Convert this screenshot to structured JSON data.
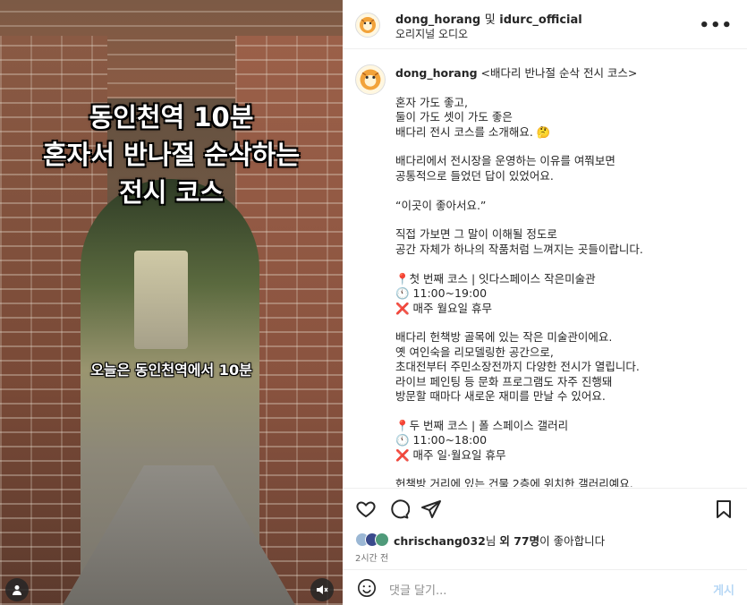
{
  "video": {
    "overlay_title_lines": [
      "동인천역 10분",
      "혼자서 반나절 순삭하는",
      "전시 코스"
    ],
    "overlay_subtitle": "오늘은 동인천역에서 10분",
    "user_icon": "user-icon",
    "mute_icon": "speaker-muted-icon"
  },
  "header": {
    "author": "dong_horang",
    "and_text": "및",
    "collaborator": "idurc_official",
    "audio_label": "오리지널 오디오",
    "more_icon": "ellipsis-icon"
  },
  "caption": {
    "username": "dong_horang",
    "text": " <배다리 반나절 순삭 전시 코스>\n\n혼자 가도 좋고,\n둘이 가도 셋이 가도 좋은\n배다리 전시 코스를 소개해요. 🤔\n\n배다리에서 전시장을 운영하는 이유를 여쭤보면\n공통적으로 들었던 답이 있었어요.\n\n“이곳이 좋아서요.”\n\n직접 가보면 그 말이 이해될 정도로\n공간 자체가 하나의 작품처럼 느껴지는 곳들이랍니다.\n\n📍첫 번째 코스 | 잇다스페이스 작은미술관\n🕚 11:00~19:00\n❌ 매주 월요일 휴무\n\n배다리 헌책방 골목에 있는 작은 미술관이에요.\n옛 여인숙을 리모델링한 공간으로,\n초대전부터 주민소장전까지 다양한 전시가 열립니다.\n라이브 페인팅 등 문화 프로그램도 자주 진행돼\n방문할 때마다 새로운 재미를 만날 수 있어요.\n\n📍두 번째 코스 | 폴 스페이스 갤러리\n🕚 11:00~18:00\n❌ 매주 일·월요일 휴무\n\n헌책방 거리에 있는 건물 2층에 위치한 갤러리예요."
  },
  "actions": {
    "like_icon": "heart-icon",
    "comment_icon": "comment-icon",
    "share_icon": "send-icon",
    "save_icon": "bookmark-icon"
  },
  "likes": {
    "user": "chrischang032",
    "suffix_1": "님 ",
    "others": "외 77명",
    "suffix_2": "이 좋아합니다"
  },
  "time_ago": "2시간 전",
  "comment": {
    "placeholder": "댓글 달기...",
    "post_label": "게시",
    "emoji_icon": "smiley-icon"
  },
  "colors": {
    "post_disabled": "#b6d7f5",
    "muted_text": "#737373",
    "border": "#efefef"
  }
}
